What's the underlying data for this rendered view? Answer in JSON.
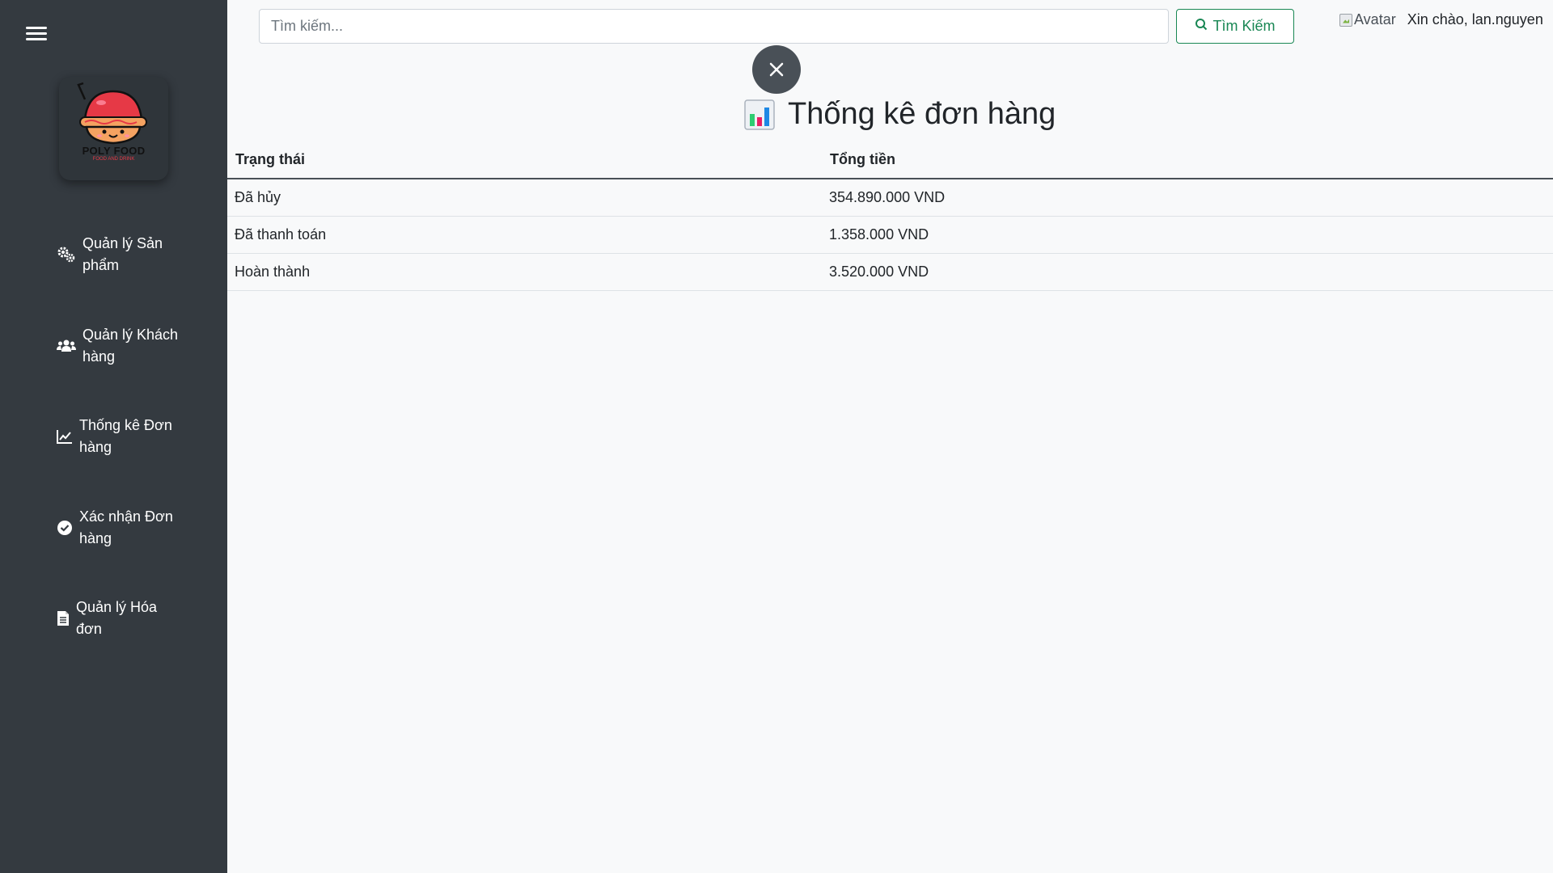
{
  "sidebar": {
    "brand": {
      "name": "POLY FOOD",
      "tagline": "FOOD AND DRINK"
    },
    "items": [
      {
        "label": "Quản lý Sản phẩm",
        "icon": "gears-icon"
      },
      {
        "label": "Quản lý Khách hàng",
        "icon": "users-icon"
      },
      {
        "label": "Thống kê Đơn hàng",
        "icon": "line-chart-icon"
      },
      {
        "label": "Xác nhận Đơn hàng",
        "icon": "check-circle-icon"
      },
      {
        "label": "Quản lý Hóa đơn",
        "icon": "invoice-icon"
      }
    ]
  },
  "header": {
    "search_placeholder": "Tìm kiếm...",
    "search_button": "Tìm Kiếm",
    "avatar_alt": "Avatar",
    "greeting": "Xin chào, lan.nguyen"
  },
  "main": {
    "title": "Thống kê đơn hàng",
    "table": {
      "headers": [
        "Trạng thái",
        "Tổng tiền"
      ],
      "rows": [
        [
          "Đã hủy",
          "354.890.000 VND"
        ],
        [
          "Đã thanh toán",
          "1.358.000 VND"
        ],
        [
          "Hoàn thành",
          "3.520.000 VND"
        ]
      ]
    }
  },
  "colors": {
    "sidebar_bg": "#343a40",
    "accent_green": "#198754",
    "page_bg": "#f8f9fa"
  }
}
